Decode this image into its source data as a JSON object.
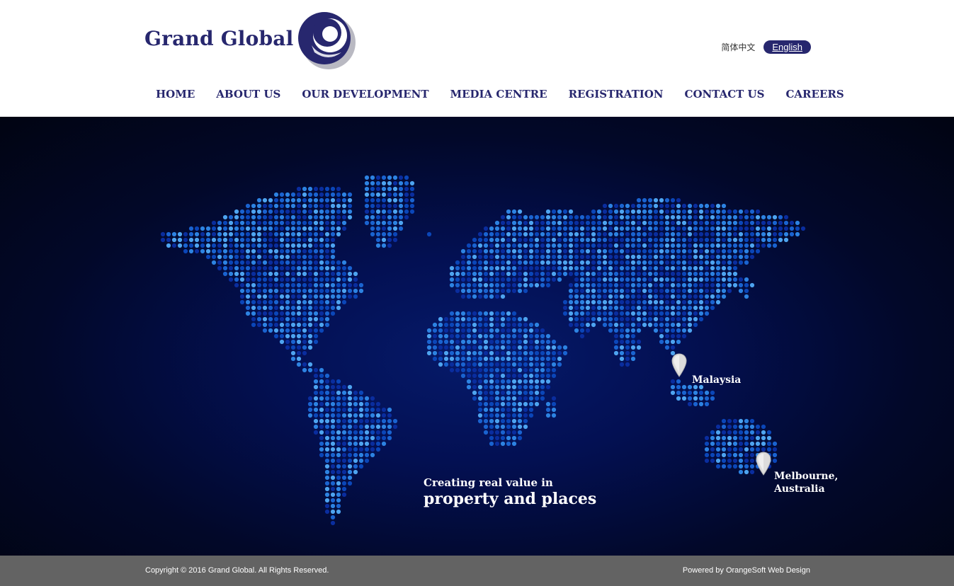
{
  "brand": {
    "name": "Grand Global",
    "primary_color": "#27276e",
    "logo_icon": "crescent-swirl-icon"
  },
  "language": {
    "chinese_label": "简体中文",
    "english_label": "English",
    "active": "English"
  },
  "nav": {
    "items": [
      {
        "label": "HOME"
      },
      {
        "label": "ABOUT US"
      },
      {
        "label": "OUR DEVELOPMENT"
      },
      {
        "label": "MEDIA CENTRE"
      },
      {
        "label": "REGISTRATION"
      },
      {
        "label": "CONTACT US"
      },
      {
        "label": "CAREERS"
      }
    ]
  },
  "hero": {
    "background_color": "#020829",
    "dot_colors": [
      "#0a2d9e",
      "#1a63d0",
      "#2d83e2",
      "#4ea4f0",
      "#0b46b8"
    ],
    "pins": [
      {
        "label": "Malaysia",
        "icon": "map-pin-icon"
      },
      {
        "label_line1": "Melbourne,",
        "label_line2": "Australia",
        "icon": "map-pin-icon"
      }
    ],
    "tagline_line1": "Creating real value in",
    "tagline_line2": "property and places"
  },
  "footer": {
    "copyright": "Copyright © 2016 Grand Global. All Rights Reserved.",
    "powered_by": "Powered by OrangeSoft Web Design",
    "background_color": "#636363"
  }
}
